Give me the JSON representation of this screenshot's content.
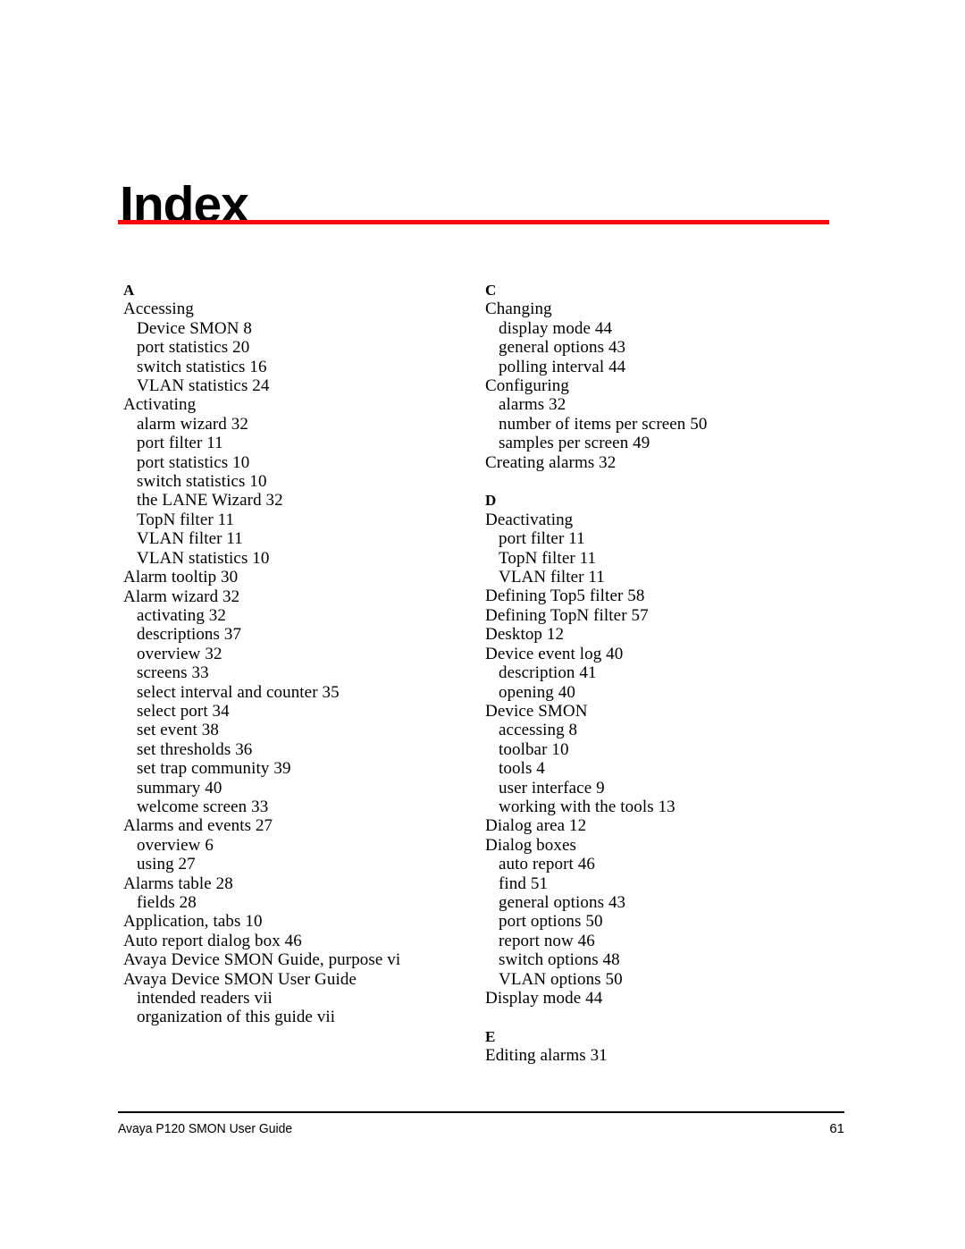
{
  "document": {
    "title": "Index",
    "accent_rule_color": "#fb0a08",
    "footer_rule_color": "#000000"
  },
  "footer": {
    "guide_title": "Avaya P120 SMON User Guide",
    "page_number": "61"
  },
  "index": {
    "left_column": [
      {
        "letter": "A",
        "entries": [
          {
            "level": 1,
            "text": "Accessing"
          },
          {
            "level": 2,
            "text": "Device SMON 8"
          },
          {
            "level": 2,
            "text": "port statistics 20"
          },
          {
            "level": 2,
            "text": "switch statistics 16"
          },
          {
            "level": 2,
            "text": "VLAN statistics 24"
          },
          {
            "level": 1,
            "text": "Activating"
          },
          {
            "level": 2,
            "text": "alarm wizard 32"
          },
          {
            "level": 2,
            "text": "port filter 11"
          },
          {
            "level": 2,
            "text": "port statistics 10"
          },
          {
            "level": 2,
            "text": "switch statistics 10"
          },
          {
            "level": 2,
            "text": "the LANE Wizard 32"
          },
          {
            "level": 2,
            "text": "TopN filter 11"
          },
          {
            "level": 2,
            "text": "VLAN filter 11"
          },
          {
            "level": 2,
            "text": "VLAN statistics 10"
          },
          {
            "level": 1,
            "text": "Alarm tooltip 30"
          },
          {
            "level": 1,
            "text": "Alarm wizard 32"
          },
          {
            "level": 2,
            "text": "activating 32"
          },
          {
            "level": 2,
            "text": "descriptions 37"
          },
          {
            "level": 2,
            "text": "overview 32"
          },
          {
            "level": 2,
            "text": "screens 33"
          },
          {
            "level": 2,
            "text": "select interval and counter 35"
          },
          {
            "level": 2,
            "text": "select port 34"
          },
          {
            "level": 2,
            "text": "set event 38"
          },
          {
            "level": 2,
            "text": "set thresholds 36"
          },
          {
            "level": 2,
            "text": "set trap community 39"
          },
          {
            "level": 2,
            "text": "summary 40"
          },
          {
            "level": 2,
            "text": "welcome screen 33"
          },
          {
            "level": 1,
            "text": "Alarms and events 27"
          },
          {
            "level": 2,
            "text": "overview 6"
          },
          {
            "level": 2,
            "text": "using 27"
          },
          {
            "level": 1,
            "text": "Alarms table 28"
          },
          {
            "level": 2,
            "text": "fields 28"
          },
          {
            "level": 1,
            "text": "Application, tabs 10"
          },
          {
            "level": 1,
            "text": "Auto report dialog box 46"
          },
          {
            "level": 1,
            "text": "Avaya Device SMON Guide, purpose vi"
          },
          {
            "level": 1,
            "text": "Avaya Device SMON User Guide"
          },
          {
            "level": 2,
            "text": "intended readers vii"
          },
          {
            "level": 2,
            "text": "organization of this guide vii"
          }
        ]
      }
    ],
    "right_column": [
      {
        "letter": "C",
        "entries": [
          {
            "level": 1,
            "text": "Changing"
          },
          {
            "level": 2,
            "text": "display mode 44"
          },
          {
            "level": 2,
            "text": "general options 43"
          },
          {
            "level": 2,
            "text": "polling interval 44"
          },
          {
            "level": 1,
            "text": "Configuring"
          },
          {
            "level": 2,
            "text": "alarms 32"
          },
          {
            "level": 2,
            "text": "number of items per screen 50"
          },
          {
            "level": 2,
            "text": "samples per screen 49"
          },
          {
            "level": 1,
            "text": "Creating alarms 32"
          }
        ]
      },
      {
        "letter": "D",
        "entries": [
          {
            "level": 1,
            "text": "Deactivating"
          },
          {
            "level": 2,
            "text": "port filter 11"
          },
          {
            "level": 2,
            "text": "TopN filter 11"
          },
          {
            "level": 2,
            "text": "VLAN filter 11"
          },
          {
            "level": 1,
            "text": "Defining Top5 filter 58"
          },
          {
            "level": 1,
            "text": "Defining TopN filter 57"
          },
          {
            "level": 1,
            "text": "Desktop 12"
          },
          {
            "level": 1,
            "text": "Device event log 40"
          },
          {
            "level": 2,
            "text": "description 41"
          },
          {
            "level": 2,
            "text": "opening 40"
          },
          {
            "level": 1,
            "text": "Device SMON"
          },
          {
            "level": 2,
            "text": "accessing 8"
          },
          {
            "level": 2,
            "text": "toolbar 10"
          },
          {
            "level": 2,
            "text": "tools 4"
          },
          {
            "level": 2,
            "text": "user interface 9"
          },
          {
            "level": 2,
            "text": "working with the tools 13"
          },
          {
            "level": 1,
            "text": "Dialog area 12"
          },
          {
            "level": 1,
            "text": "Dialog boxes"
          },
          {
            "level": 2,
            "text": "auto report 46"
          },
          {
            "level": 2,
            "text": "find 51"
          },
          {
            "level": 2,
            "text": "general options 43"
          },
          {
            "level": 2,
            "text": "port options 50"
          },
          {
            "level": 2,
            "text": "report now 46"
          },
          {
            "level": 2,
            "text": "switch options 48"
          },
          {
            "level": 2,
            "text": "VLAN options 50"
          },
          {
            "level": 1,
            "text": "Display mode 44"
          }
        ]
      },
      {
        "letter": "E",
        "entries": [
          {
            "level": 1,
            "text": "Editing alarms 31"
          }
        ]
      }
    ]
  }
}
